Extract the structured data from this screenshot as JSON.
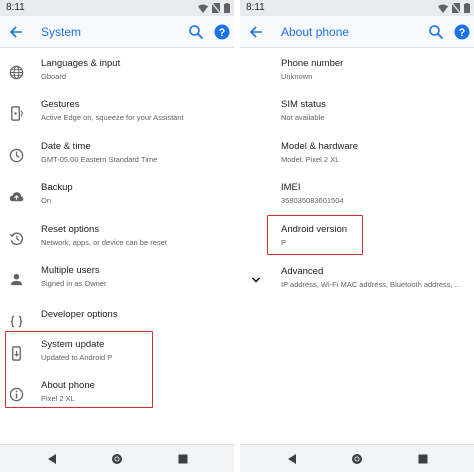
{
  "colors": {
    "accent": "#1a73e8",
    "highlight": "#d32f2f",
    "text": "#202124",
    "secondary": "#5f6368"
  },
  "left": {
    "status_time": "8:11",
    "title": "System",
    "items": [
      {
        "title": "Languages & input",
        "subtitle": "Gboard",
        "icon": "globe-icon"
      },
      {
        "title": "Gestures",
        "subtitle": "Active Edge on, squeeze for your Assistant",
        "icon": "gesture-phone-icon"
      },
      {
        "title": "Date & time",
        "subtitle": "GMT-05:00 Eastern Standard Time",
        "icon": "clock-icon"
      },
      {
        "title": "Backup",
        "subtitle": "On",
        "icon": "cloud-upload-icon"
      },
      {
        "title": "Reset options",
        "subtitle": "Network, apps, or device can be reset",
        "icon": "history-icon"
      },
      {
        "title": "Multiple users",
        "subtitle": "Signed in as Owner",
        "icon": "person-icon"
      },
      {
        "title": "Developer options",
        "subtitle": "",
        "icon": "braces-icon"
      },
      {
        "title": "System update",
        "subtitle": "Updated to Android P",
        "icon": "system-update-icon"
      },
      {
        "title": "About phone",
        "subtitle": "Pixel 2 XL",
        "icon": "info-icon"
      }
    ]
  },
  "right": {
    "status_time": "8:11",
    "title": "About phone",
    "items": [
      {
        "title": "Phone number",
        "subtitle": "Unknown"
      },
      {
        "title": "SIM status",
        "subtitle": "Not available"
      },
      {
        "title": "Model & hardware",
        "subtitle": "Model: Pixel 2 XL"
      },
      {
        "title": "IMEI",
        "subtitle": "358035083601504"
      },
      {
        "title": "Android version",
        "subtitle": "P"
      },
      {
        "title": "Advanced",
        "subtitle": "IP address, Wi-Fi MAC address, Bluetooth address, ...",
        "icon": "chevron-down-icon"
      }
    ]
  }
}
